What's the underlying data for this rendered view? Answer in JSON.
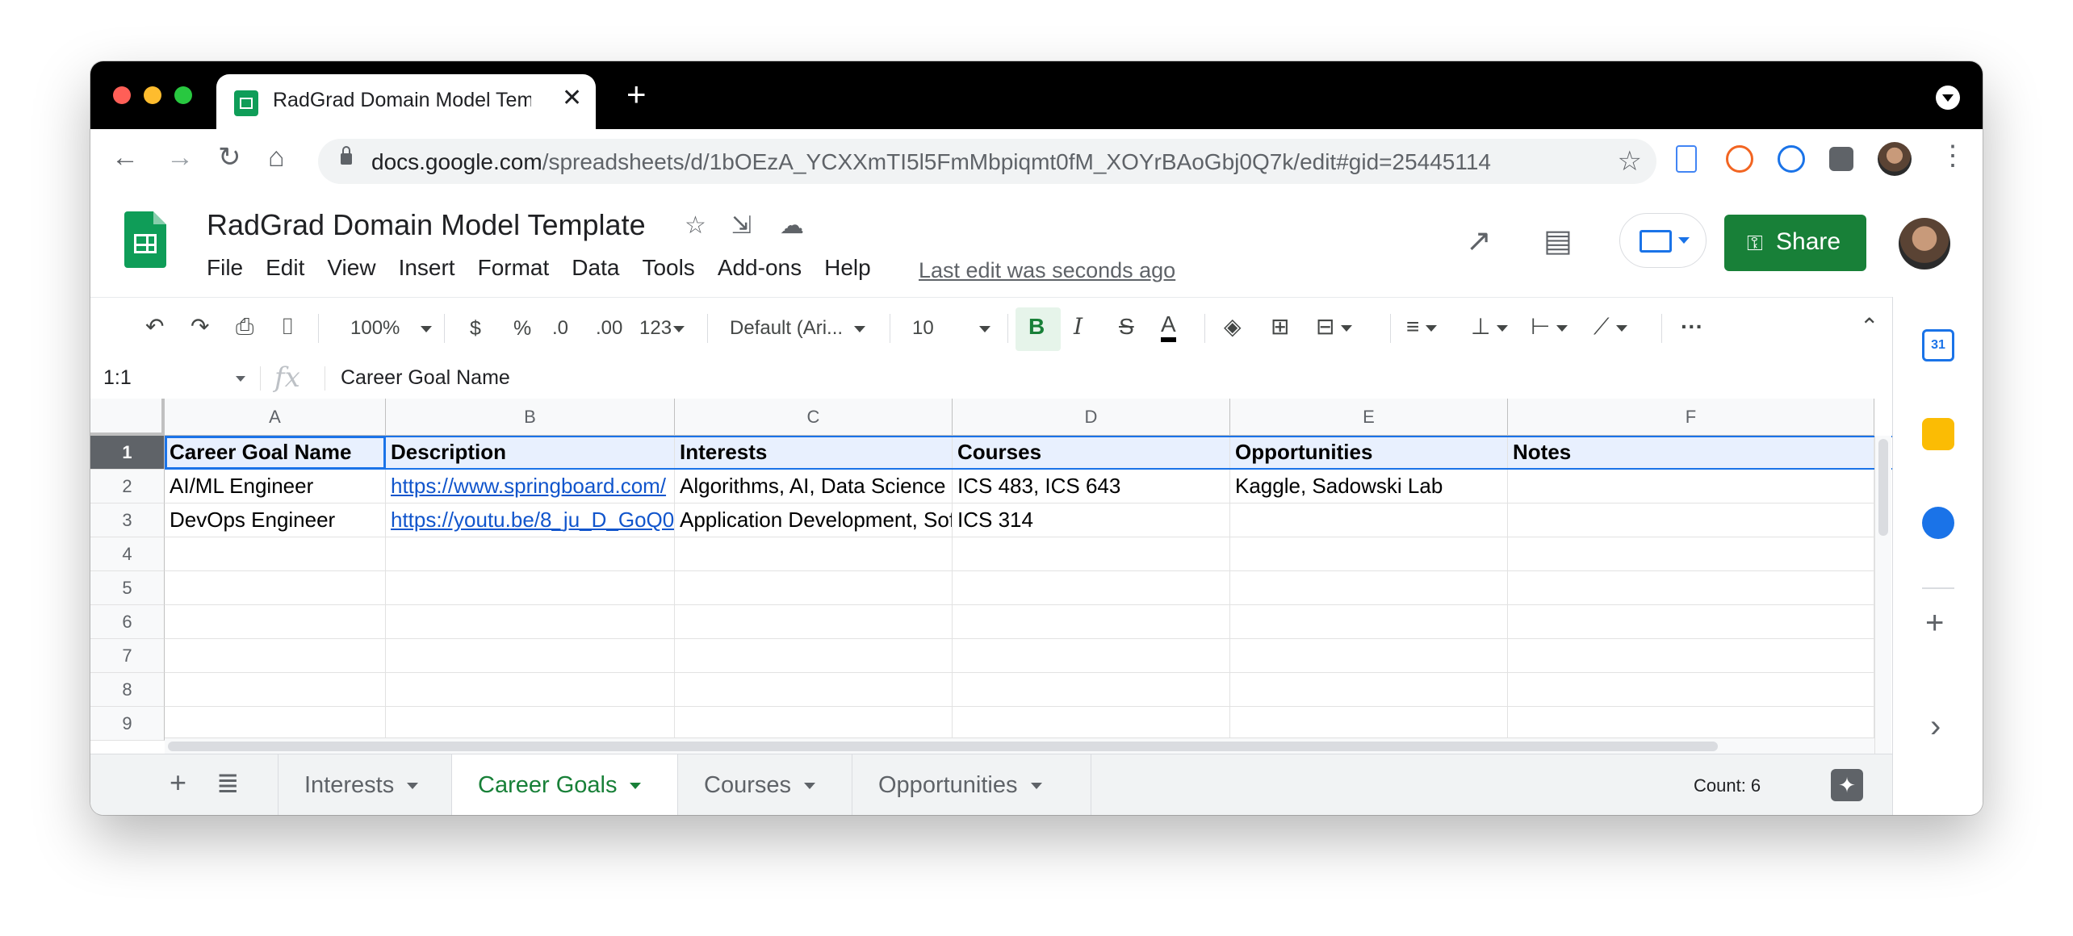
{
  "browser": {
    "tab_title": "RadGrad Domain Model Template",
    "tab_close": "✕",
    "new_tab": "+",
    "url_host": "docs.google.com",
    "url_path": "/spreadsheets/d/1bOEzA_YCXXmTI5l5FmMbpiqmt0fM_XOYrBAoGbj0Q7k/edit#gid=25445114",
    "back": "←",
    "forward": "→",
    "reload": "↻",
    "home": "⌂",
    "bookmark": "☆",
    "menu": "⋮",
    "colors": {
      "red": "#ff5f57",
      "yellow": "#febc2e",
      "green": "#28c840"
    }
  },
  "doc": {
    "title": "RadGrad Domain Model Template",
    "menus": [
      "File",
      "Edit",
      "View",
      "Insert",
      "Format",
      "Data",
      "Tools",
      "Add-ons",
      "Help"
    ],
    "last_edit": "Last edit was seconds ago",
    "share_label": "Share",
    "star_icon": "☆",
    "move_icon": "⇲",
    "cloud_icon": "☁",
    "activity_icon": "↗",
    "comments_icon": "▤",
    "brand_color": "#188038"
  },
  "toolbar": {
    "undo": "↶",
    "redo": "↷",
    "print": "⎙",
    "paint": "⌷",
    "zoom": "100%",
    "currency": "$",
    "percent": "%",
    "dec_less": ".0",
    "dec_more": ".00",
    "more_formats": "123",
    "font": "Default (Ari...",
    "font_size": "10",
    "bold": "B",
    "italic": "I",
    "strike": "S",
    "text_color": "A",
    "fill": "◈",
    "borders": "⊞",
    "merge": "⊟",
    "align": "≡",
    "valign": "⊥",
    "wrap": "⊢",
    "rotate": "⟋",
    "more": "···",
    "collapse": "⌃"
  },
  "formula_bar": {
    "name_box": "1:1",
    "fx": "fx",
    "value": "Career Goal Name"
  },
  "sheet": {
    "columns": [
      "A",
      "B",
      "C",
      "D",
      "E",
      "F"
    ],
    "row_numbers": [
      "1",
      "2",
      "3",
      "4",
      "5",
      "6",
      "7",
      "8",
      "9"
    ],
    "rows": [
      [
        "Career Goal Name",
        "Description",
        "Interests",
        "Courses",
        "Opportunities",
        "Notes"
      ],
      [
        "AI/ML Engineer",
        "https://www.springboard.com/",
        "Algorithms, AI, Data Science",
        "ICS 483, ICS 643",
        "Kaggle, Sadowski Lab",
        ""
      ],
      [
        "DevOps Engineer",
        "https://youtu.be/8_ju_D_GoQ0",
        "Application Development, Software",
        "ICS 314",
        "",
        ""
      ]
    ]
  },
  "tabs": {
    "add": "+",
    "list": "≣",
    "sheets": [
      "Interests",
      "Career Goals",
      "Courses",
      "Opportunities"
    ],
    "active": "Career Goals",
    "count": "Count: 6",
    "explore": "✦"
  },
  "side_panel": {
    "calendar_text": "31",
    "add": "+",
    "expand": "›"
  }
}
